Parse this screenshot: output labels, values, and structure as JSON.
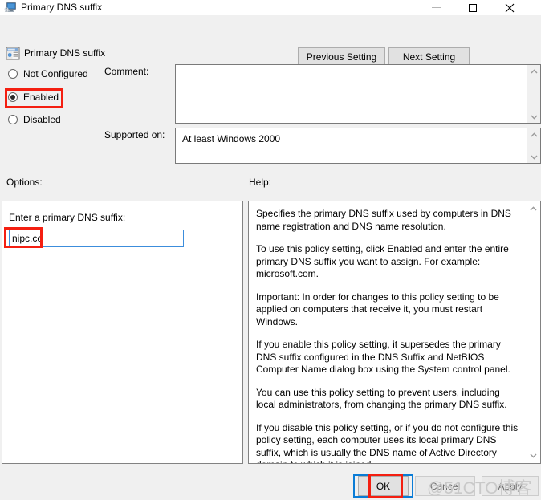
{
  "window": {
    "title": "Primary DNS suffix",
    "icon": "computer-icon",
    "controls": {
      "minimize": "minimize-icon",
      "maximize": "maximize-icon",
      "close": "close-icon"
    }
  },
  "header": {
    "icon": "policy-setting-icon",
    "title": "Primary DNS suffix",
    "previous_label": "Previous Setting",
    "next_label": "Next Setting"
  },
  "state": {
    "options": [
      {
        "label": "Not Configured",
        "selected": false
      },
      {
        "label": "Enabled",
        "selected": true
      },
      {
        "label": "Disabled",
        "selected": false
      }
    ]
  },
  "comment": {
    "label": "Comment:",
    "value": "",
    "placeholder": ""
  },
  "supported": {
    "label": "Supported on:",
    "value": "At least Windows 2000"
  },
  "options_panel": {
    "label": "Options:",
    "field_label": "Enter a primary DNS suffix:",
    "field_value": "nipc.cc",
    "field_placeholder": ""
  },
  "help_panel": {
    "label": "Help:",
    "paragraphs": [
      "Specifies the primary DNS suffix used by computers in DNS name registration and DNS name resolution.",
      "To use this policy setting, click Enabled and enter the entire primary DNS suffix you want to assign. For example: microsoft.com.",
      "Important: In order for changes to this policy setting to be applied on computers that receive it, you must restart Windows.",
      "If you enable this policy setting, it supersedes the primary DNS suffix configured in the DNS Suffix and NetBIOS Computer Name dialog box using the System control panel.",
      "You can use this policy setting to prevent users, including local administrators, from changing the primary DNS suffix.",
      "If you disable this policy setting, or if you do not configure this policy setting, each computer uses its local primary DNS suffix, which is usually the DNS name of Active Directory domain to which it is joined."
    ]
  },
  "footer": {
    "ok_label": "OK",
    "cancel_label": "Cancel",
    "apply_label": "Apply"
  },
  "watermark": {
    "text": "@51CTO博客"
  },
  "colors": {
    "annotation": "#f41f11",
    "focus": "#0a7cd6",
    "window_bg": "#f0f0f0",
    "field_bg": "#ffffff"
  }
}
